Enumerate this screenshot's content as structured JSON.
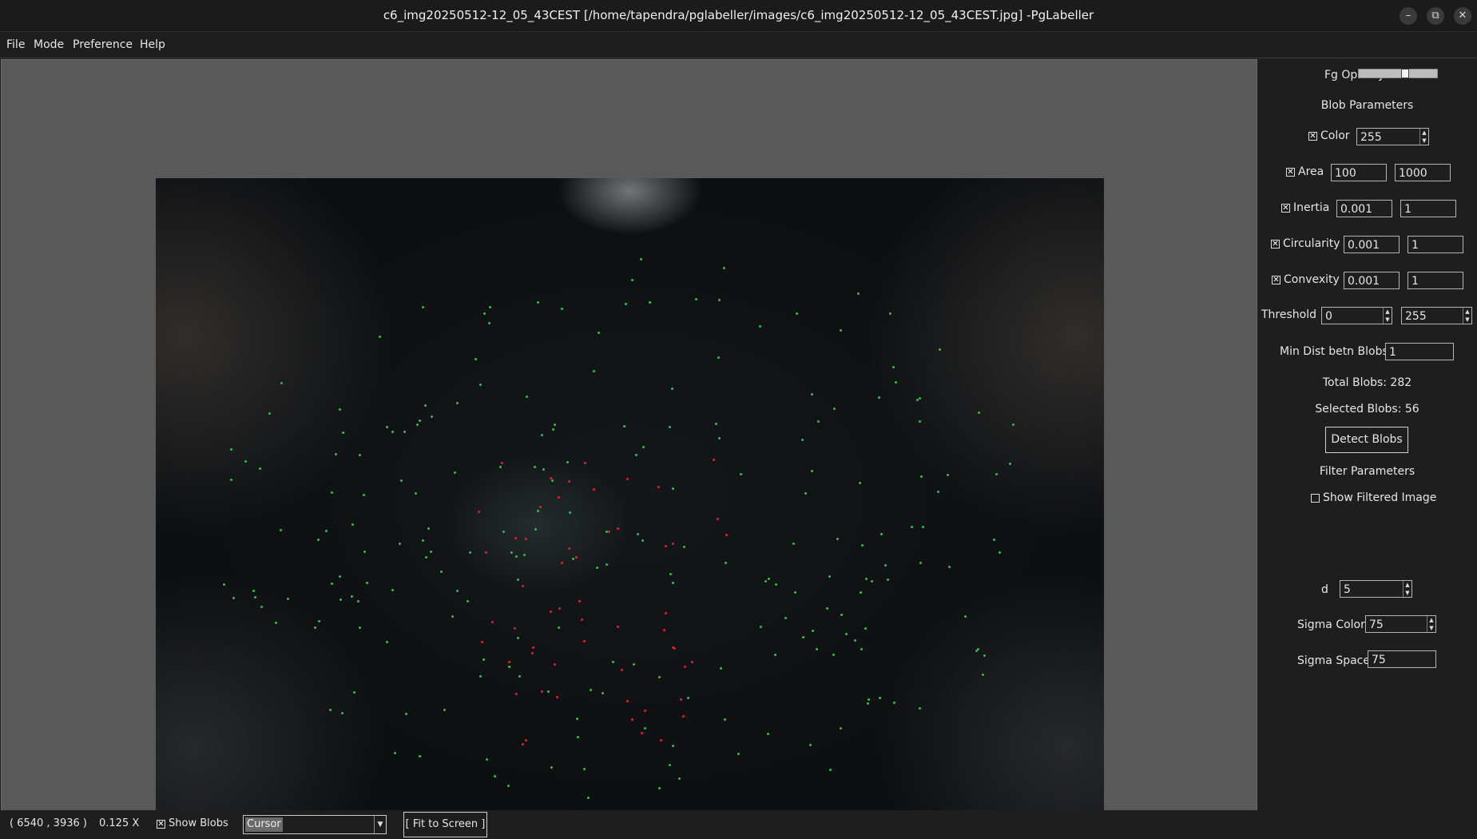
{
  "window": {
    "title": "c6_img20250512-12_05_43CEST [/home/tapendra/pglabeller/images/c6_img20250512-12_05_43CEST.jpg] -PgLabeller"
  },
  "menu": {
    "file": "File",
    "mode": "Mode",
    "preference": "Preference",
    "help": "Help"
  },
  "panel": {
    "fg_opacity_label": "Fg Opacity",
    "fg_opacity_value": 0.6,
    "blob_params_header": "Blob Parameters",
    "color": {
      "label": "Color",
      "checked": true,
      "value": "255"
    },
    "area": {
      "label": "Area",
      "checked": true,
      "min": "100",
      "max": "1000"
    },
    "inertia": {
      "label": "Inertia",
      "checked": true,
      "min": "0.001",
      "max": "1"
    },
    "circularity": {
      "label": "Circularity",
      "checked": true,
      "min": "0.001",
      "max": "1"
    },
    "convexity": {
      "label": "Convexity",
      "checked": true,
      "min": "0.001",
      "max": "1"
    },
    "threshold": {
      "label": "Threshold",
      "min": "0",
      "max": "255"
    },
    "min_dist": {
      "label": "Min Dist betn Blobs",
      "value": "1"
    },
    "total_blobs": "Total Blobs: 282",
    "selected_blobs": "Selected Blobs: 56",
    "detect_button": "Detect Blobs",
    "filter_params_header": "Filter Parameters",
    "show_filtered": {
      "label": "Show Filtered Image",
      "checked": false
    },
    "d": {
      "label": "d",
      "value": "5"
    },
    "sigma_color": {
      "label": "Sigma Color",
      "value": "75"
    },
    "sigma_space": {
      "label": "Sigma Space",
      "value": "75"
    }
  },
  "status": {
    "coords": "( 6540 , 3936 )",
    "zoom": "0.125 X",
    "show_blobs": {
      "label": "Show Blobs",
      "checked": true
    },
    "mode_select": "Cursor",
    "fit_button": "[ Fit to Screen ]"
  },
  "colors": {
    "blob_green": "#2fbf4a",
    "blob_red": "#e02030",
    "canvas_bg": "#595959",
    "panel_bg": "#1e1e1e"
  }
}
